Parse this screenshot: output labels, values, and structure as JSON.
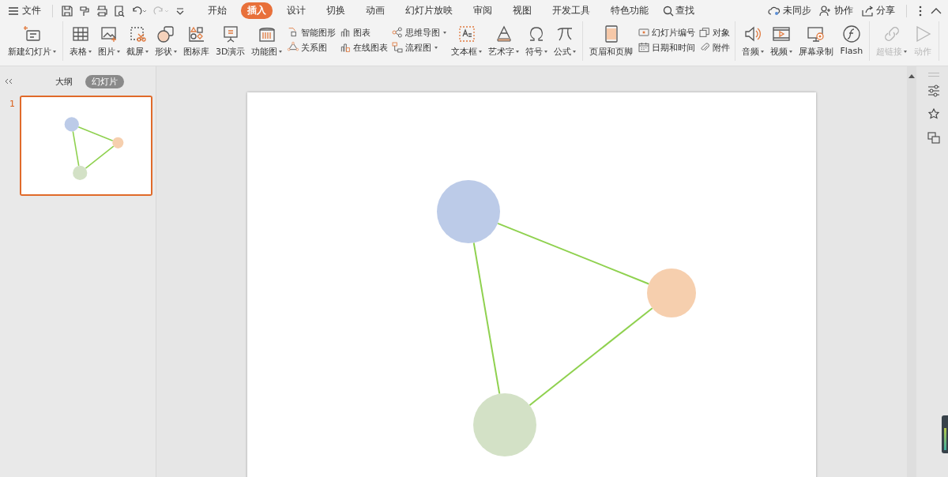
{
  "menu": {
    "file_label": "文件",
    "tabs": [
      {
        "label": "开始",
        "selected": false
      },
      {
        "label": "插入",
        "selected": true
      },
      {
        "label": "设计",
        "selected": false
      },
      {
        "label": "切换",
        "selected": false
      },
      {
        "label": "动画",
        "selected": false
      },
      {
        "label": "幻灯片放映",
        "selected": false
      },
      {
        "label": "审阅",
        "selected": false
      },
      {
        "label": "视图",
        "selected": false
      },
      {
        "label": "开发工具",
        "selected": false
      },
      {
        "label": "特色功能",
        "selected": false
      }
    ],
    "search_label": "查找",
    "actions": [
      "未同步",
      "协作",
      "分享"
    ]
  },
  "ribbon": {
    "groups": [
      [
        {
          "kind": "large",
          "label": "新建幻灯片",
          "dropdown": true,
          "disabled": false
        }
      ],
      [
        {
          "kind": "large",
          "label": "表格",
          "dropdown": true,
          "disabled": false
        },
        {
          "kind": "large",
          "label": "图片",
          "dropdown": true,
          "disabled": false
        },
        {
          "kind": "large",
          "label": "截屏",
          "dropdown": true,
          "disabled": false
        },
        {
          "kind": "large",
          "label": "形状",
          "dropdown": true,
          "disabled": false
        },
        {
          "kind": "large",
          "label": "图标库",
          "dropdown": false,
          "disabled": false
        },
        {
          "kind": "large",
          "label": "3D演示",
          "dropdown": false,
          "disabled": false
        },
        {
          "kind": "large",
          "label": "功能图",
          "dropdown": true,
          "disabled": false
        },
        {
          "kind": "stack",
          "items": [
            {
              "label": "智能图形",
              "dropdown": false,
              "disabled": false
            },
            {
              "label": "关系图",
              "dropdown": false,
              "disabled": false
            }
          ]
        },
        {
          "kind": "stack",
          "items": [
            {
              "label": "图表",
              "dropdown": false,
              "disabled": false
            },
            {
              "label": "在线图表",
              "dropdown": false,
              "disabled": false
            }
          ]
        },
        {
          "kind": "stack",
          "items": [
            {
              "label": "思维导图",
              "dropdown": true,
              "disabled": false
            },
            {
              "label": "流程图",
              "dropdown": true,
              "disabled": false
            }
          ]
        },
        {
          "kind": "large",
          "label": "文本框",
          "dropdown": true,
          "disabled": false
        },
        {
          "kind": "large",
          "label": "艺术字",
          "dropdown": true,
          "disabled": false
        },
        {
          "kind": "large",
          "label": "符号",
          "dropdown": true,
          "disabled": false
        },
        {
          "kind": "large",
          "label": "公式",
          "dropdown": true,
          "disabled": false
        }
      ],
      [
        {
          "kind": "large",
          "label": "页眉和页脚",
          "dropdown": false,
          "disabled": false
        },
        {
          "kind": "stack",
          "items": [
            {
              "label": "幻灯片编号",
              "dropdown": false,
              "disabled": false
            },
            {
              "label": "日期和时间",
              "dropdown": false,
              "disabled": false
            }
          ]
        },
        {
          "kind": "stack",
          "items": [
            {
              "label": "对象",
              "dropdown": false,
              "disabled": false
            },
            {
              "label": "附件",
              "dropdown": false,
              "disabled": false
            }
          ]
        }
      ],
      [
        {
          "kind": "large",
          "label": "音频",
          "dropdown": true,
          "disabled": false
        },
        {
          "kind": "large",
          "label": "视频",
          "dropdown": true,
          "disabled": false
        },
        {
          "kind": "large",
          "label": "屏幕录制",
          "dropdown": false,
          "disabled": false
        },
        {
          "kind": "large",
          "label": "Flash",
          "dropdown": false,
          "disabled": false
        }
      ],
      [
        {
          "kind": "large",
          "label": "超链接",
          "dropdown": true,
          "disabled": true
        },
        {
          "kind": "large",
          "label": "动作",
          "dropdown": false,
          "disabled": true
        }
      ]
    ]
  },
  "side_panel": {
    "tabs": [
      {
        "label": "大纲",
        "selected": false
      },
      {
        "label": "幻灯片",
        "selected": true
      }
    ],
    "slides": [
      {
        "number": "1",
        "selected": true
      }
    ]
  },
  "slide": {
    "shapes": [
      {
        "color": "#bccbe8"
      },
      {
        "color": "#f6cfae"
      },
      {
        "color": "#d3e1c6"
      }
    ]
  }
}
